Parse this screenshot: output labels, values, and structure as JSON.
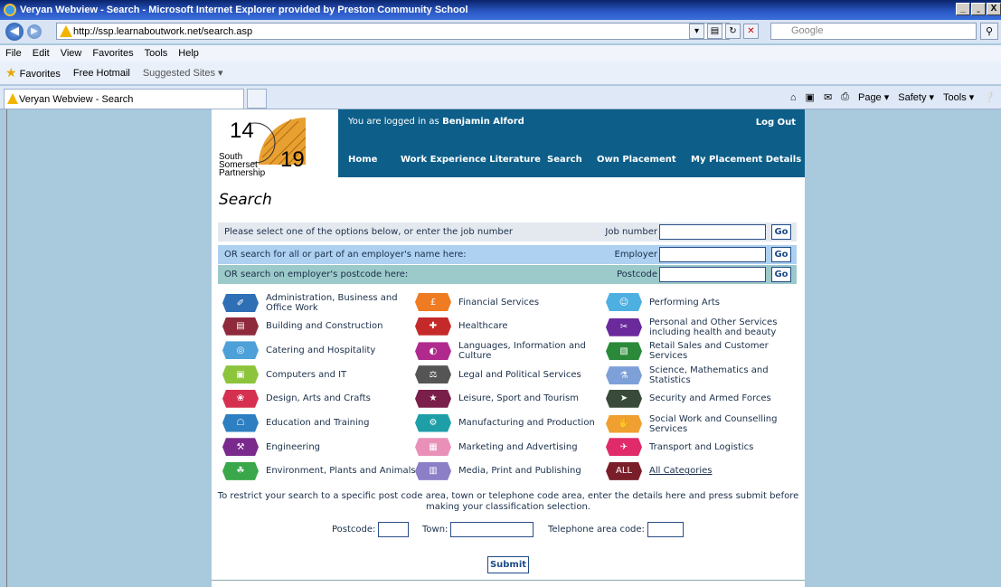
{
  "window": {
    "title": "Veryan Webview - Search - Microsoft Internet Explorer provided by Preston Community School",
    "buttons": [
      "_",
      "̱",
      "X"
    ]
  },
  "address": {
    "url": "http://ssp.learnaboutwork.net/search.asp",
    "search_placeholder": "Google"
  },
  "menu": [
    "File",
    "Edit",
    "View",
    "Favorites",
    "Tools",
    "Help"
  ],
  "favorites": {
    "label": "Favorites",
    "items": [
      "Free Hotmail",
      "Suggested Sites ▾"
    ]
  },
  "tab": {
    "title": "Veryan Webview - Search"
  },
  "commandbar": [
    "Page ▾",
    "Safety ▾",
    "Tools ▾"
  ],
  "logo": {
    "top": "14",
    "bottom": "19",
    "org": [
      "South",
      "Somerset",
      "Partnership"
    ]
  },
  "header": {
    "login_text": "You are logged in as",
    "user": "Benjamin Alford",
    "logout": "Log Out",
    "nav": [
      "Home",
      "Work Experience Literature",
      "Search",
      "Own Placement",
      "My Placement Details"
    ]
  },
  "page_title": "Search",
  "search_rows": [
    {
      "text": "Please select one of the options below, or enter the job number",
      "label": "Job number",
      "go": "Go",
      "bg": "#e4e9ef"
    },
    {
      "text": "OR search for all or part of an employer's name here:",
      "label": "Employer",
      "go": "Go",
      "bg": "#aed1f2"
    },
    {
      "text": "OR search on employer's postcode here:",
      "label": "Postcode",
      "go": "Go",
      "bg": "#9cc9c9"
    }
  ],
  "categories": [
    {
      "label": "Administration, Business and Office Work",
      "color": "#2e6fb5",
      "icon": "✐"
    },
    {
      "label": "Building and Construction",
      "color": "#8e2a3b",
      "icon": "▤"
    },
    {
      "label": "Catering and Hospitality",
      "color": "#4ea0d8",
      "icon": "◎"
    },
    {
      "label": "Computers and IT",
      "color": "#8cc43c",
      "icon": "▣"
    },
    {
      "label": "Design, Arts and Crafts",
      "color": "#d63050",
      "icon": "❀"
    },
    {
      "label": "Education and Training",
      "color": "#2d7fc1",
      "icon": "☖"
    },
    {
      "label": "Engineering",
      "color": "#7a2a8c",
      "icon": "⚒"
    },
    {
      "label": "Environment, Plants and Animals",
      "color": "#3aa84a",
      "icon": "☘"
    },
    {
      "label": "Financial Services",
      "color": "#ef7b22",
      "icon": "£"
    },
    {
      "label": "Healthcare",
      "color": "#c52a2a",
      "icon": "✚"
    },
    {
      "label": "Languages, Information and Culture",
      "color": "#b02a8e",
      "icon": "◐"
    },
    {
      "label": "Legal and Political Services",
      "color": "#555555",
      "icon": "⚖"
    },
    {
      "label": "Leisure, Sport and Tourism",
      "color": "#7a1f4a",
      "icon": "★"
    },
    {
      "label": "Manufacturing and Production",
      "color": "#1e9fa8",
      "icon": "⚙"
    },
    {
      "label": "Marketing and Advertising",
      "color": "#e890b8",
      "icon": "▦"
    },
    {
      "label": "Media, Print and Publishing",
      "color": "#8c7fc8",
      "icon": "▥"
    },
    {
      "label": "Performing Arts",
      "color": "#4eb0e0",
      "icon": "☺"
    },
    {
      "label": "Personal and Other Services including health and beauty",
      "color": "#6a2a9c",
      "icon": "✂"
    },
    {
      "label": "Retail Sales and Customer Services",
      "color": "#2a8a3a",
      "icon": "▧"
    },
    {
      "label": "Science, Mathematics and Statistics",
      "color": "#7ea0d8",
      "icon": "⚗"
    },
    {
      "label": "Security and Armed Forces",
      "color": "#3a4a3a",
      "icon": "➤"
    },
    {
      "label": "Social Work and Counselling Services",
      "color": "#f0a030",
      "icon": "✋"
    },
    {
      "label": "Transport and Logistics",
      "color": "#e02a6a",
      "icon": "✈"
    },
    {
      "label": "All Categories",
      "color": "#7a1f2a",
      "icon": "ALL"
    }
  ],
  "restrict_text": "To restrict your search to a specific post code area, town or telephone code area, enter the details here and press submit before making your classification selection.",
  "filters": {
    "postcode": "Postcode:",
    "town": "Town:",
    "phone": "Telephone area code:"
  },
  "submit": "Submit"
}
